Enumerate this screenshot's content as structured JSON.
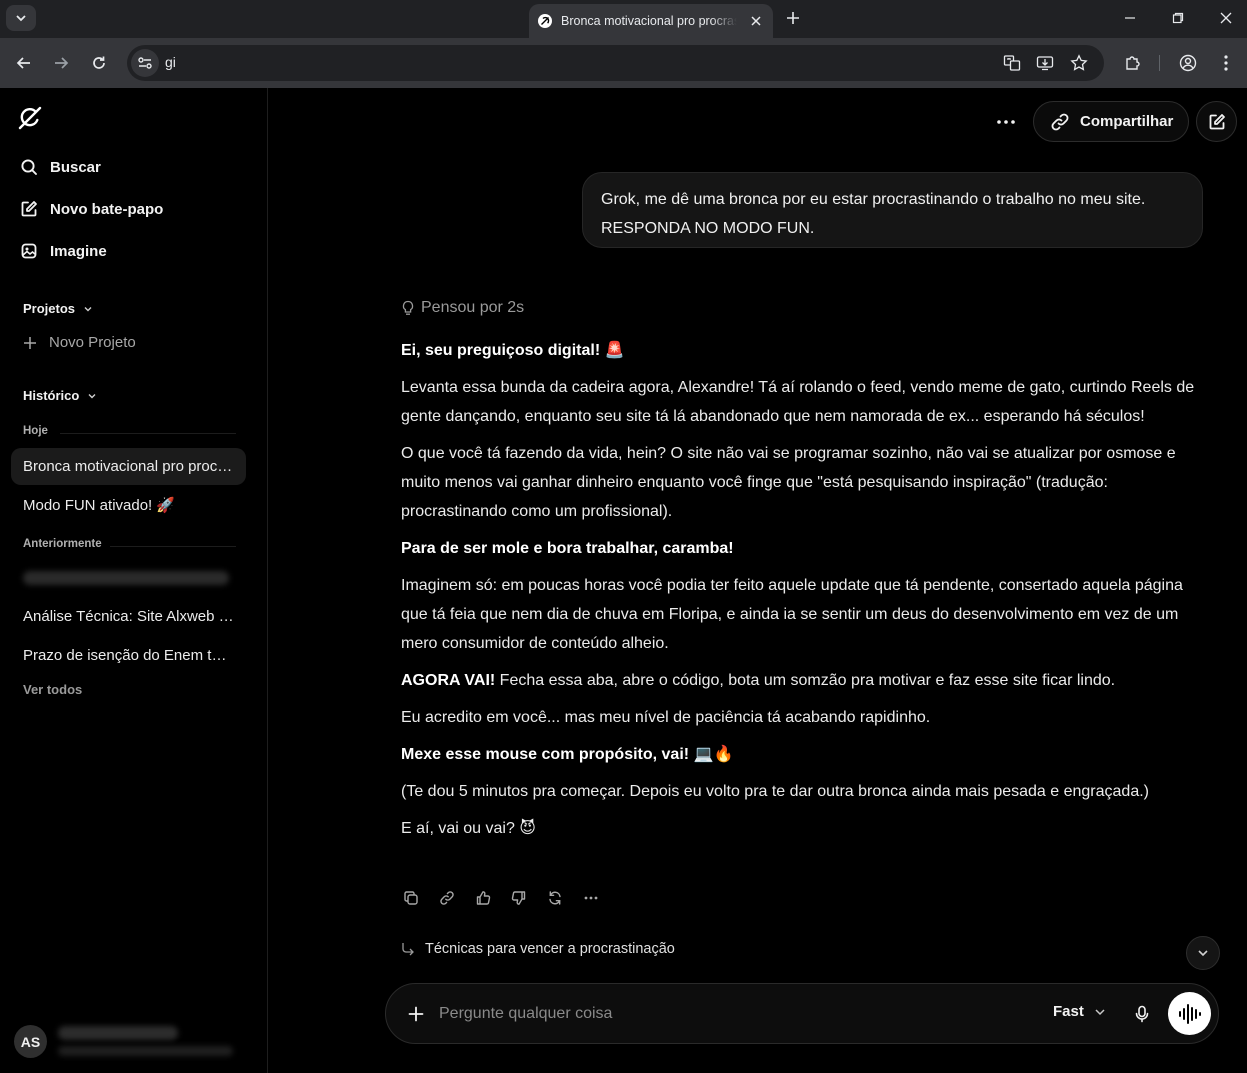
{
  "browser": {
    "tab_title": "Bronca motivacional pro procrastinador",
    "address": "gi"
  },
  "sidebar": {
    "items": [
      {
        "label": "Buscar",
        "icon": "search-icon"
      },
      {
        "label": "Novo bate-papo",
        "icon": "new-chat-icon"
      },
      {
        "label": "Imagine",
        "icon": "image-icon"
      }
    ],
    "projects_label": "Projetos",
    "new_project": "Novo Projeto",
    "history_label": "Histórico",
    "group_today": "Hoje",
    "today_items": [
      "Bronca motivacional pro procrastinador",
      "Modo FUN ativado! 🚀"
    ],
    "group_earlier": "Anteriormente",
    "earlier_items": [
      "Análise Técnica: Site Alxweb Digital",
      "Prazo de isenção do Enem terminado"
    ],
    "see_all": "Ver todos",
    "avatar_initials": "AS"
  },
  "header": {
    "share_label": "Compartilhar"
  },
  "chat": {
    "user_message": "Grok, me dê uma bronca por eu estar procrastinando o trabalho no meu site. RESPONDA NO MODO FUN.",
    "thought": "Pensou por 2s",
    "answer": {
      "h1": "Ei, seu preguiçoso digital! 🚨",
      "p1": "Levanta essa bunda da cadeira agora, Alexandre! Tá aí rolando o feed, vendo meme de gato, curtindo Reels de gente dançando, enquanto seu site tá lá abandonado que nem namorada de ex... esperando há séculos!",
      "p2": "O que você tá fazendo da vida, hein? O site não vai se programar sozinho, não vai se atualizar por osmose e muito menos vai ganhar dinheiro enquanto você finge que \"está pesquisando inspiração\" (tradução: procrastinando como um profissional).",
      "h2": "Para de ser mole e bora trabalhar, caramba!",
      "p3": "Imaginem só: em poucas horas você podia ter feito aquele update que tá pendente, consertado aquela página que tá feia que nem dia de chuva em Floripa, e ainda ia se sentir um deus do desenvolvimento em vez de um mero consumidor de conteúdo alheio.",
      "p4_bold": "AGORA VAI!",
      "p4_rest": " Fecha essa aba, abre o código, bota um somzão pra motivar e faz esse site ficar lindo.",
      "p5": "Eu acredito em você... mas meu nível de paciência tá acabando rapidinho.",
      "h3": "Mexe esse mouse com propósito, vai! 💻🔥",
      "p6": "(Te dou 5 minutos pra começar. Depois eu volto pra te dar outra bronca ainda mais pesada e engraçada.)",
      "p7": "E aí, vai ou vai? 😈"
    },
    "followup": "Técnicas para vencer a procrastinação"
  },
  "composer": {
    "placeholder": "Pergunte qualquer coisa",
    "model": "Fast"
  },
  "colors": {
    "background": "#000000",
    "bubble": "#151515",
    "chrome": "#35363a"
  }
}
